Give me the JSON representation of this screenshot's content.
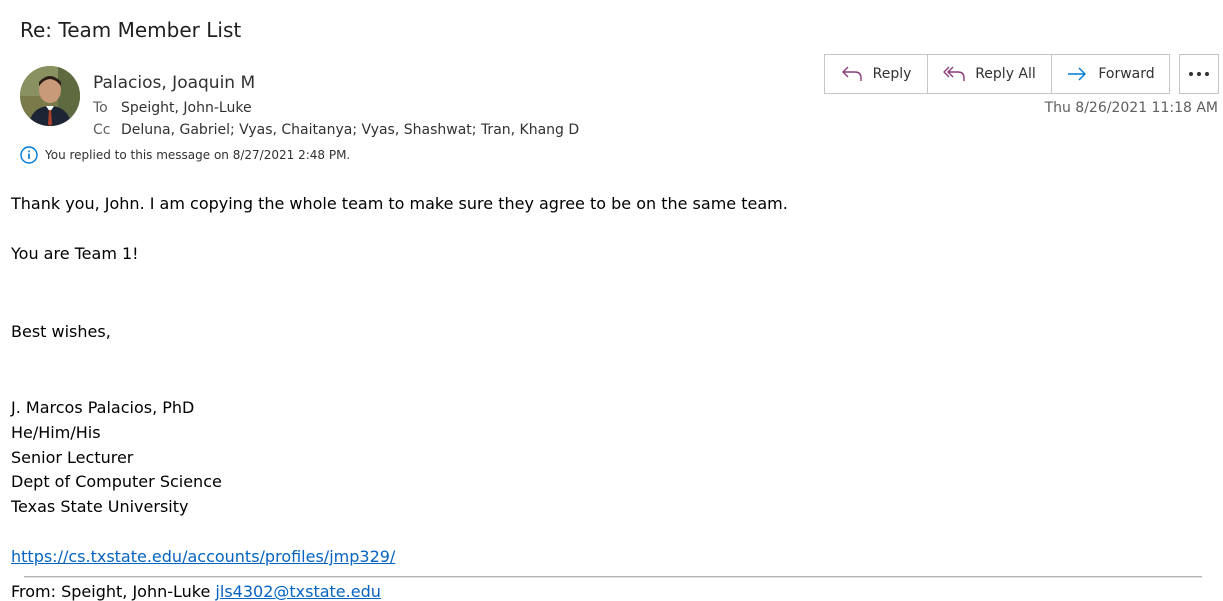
{
  "message": {
    "subject": "Re: Team Member List",
    "sender": "Palacios, Joaquin M",
    "to_label": "To",
    "to": "Speight, John-Luke",
    "cc_label": "Cc",
    "cc": "Deluna, Gabriel; Vyas, Chaitanya; Vyas, Shashwat; Tran, Khang D",
    "replied_notice": "You replied to this message on 8/27/2021 2:48 PM.",
    "timestamp": "Thu 8/26/2021 11:18 AM"
  },
  "actions": {
    "reply_label": "Reply",
    "reply_all_label": "Reply All",
    "forward_label": "Forward",
    "more_icon": "ellipsis-icon"
  },
  "body": {
    "line1": "Thank you, John. I am copying the whole team to make sure they agree to be on the same team.",
    "line2": "You are Team 1!",
    "closing": "Best wishes,",
    "signature": [
      "J. Marcos Palacios, PhD",
      "He/Him/His",
      "Senior Lecturer",
      "Dept of Computer Science",
      "Texas State University"
    ],
    "link": "https://cs.txstate.edu/accounts/profiles/jmp329/",
    "cutoff_text": "From: Speight, John-Luke ",
    "cutoff_link": "jls4302@txstate.edu"
  },
  "colors": {
    "reply_icon": "#8a3a7a",
    "forward_icon": "#0078d4",
    "info_icon": "#0078d4",
    "link": "#0563c1"
  }
}
